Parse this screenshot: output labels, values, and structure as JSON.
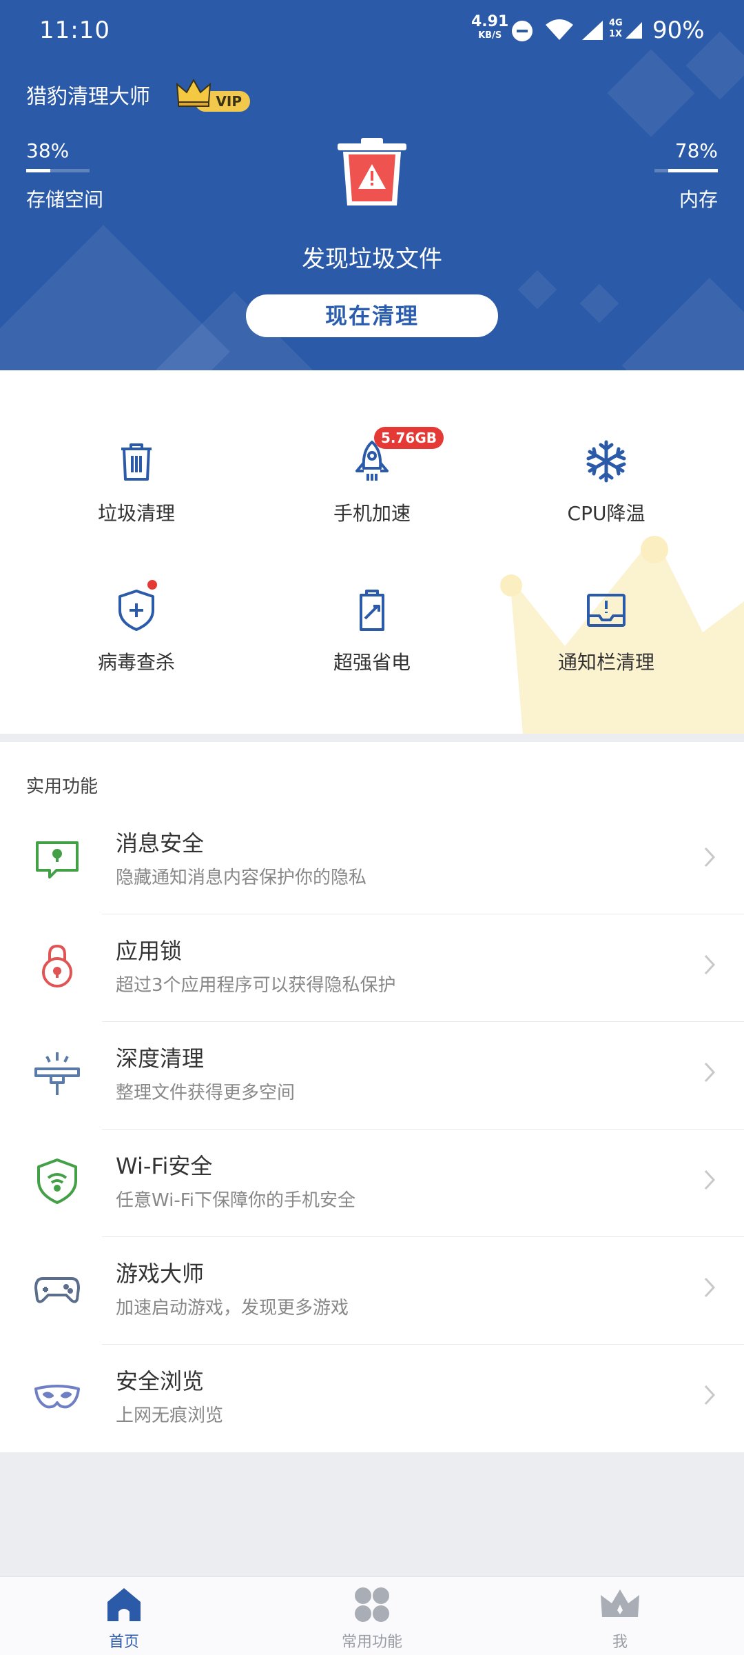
{
  "status_bar": {
    "time": "11:10",
    "net_speed": "4.91",
    "net_unit": "KB/S",
    "network_type_top": "4G",
    "network_type_bottom": "1X",
    "battery": "90%"
  },
  "header": {
    "app_title": "猎豹清理大师",
    "vip_label": "VIP",
    "storage": {
      "percent_text": "38%",
      "label": "存储空间",
      "fill_fraction": 0.38
    },
    "memory": {
      "percent_text": "78%",
      "label": "内存",
      "fill_fraction": 0.78
    },
    "found_text": "发现垃圾文件",
    "clean_button": "现在清理"
  },
  "tools": [
    {
      "label": "垃圾清理",
      "icon": "trash-icon"
    },
    {
      "label": "手机加速",
      "icon": "rocket-icon",
      "badge": "5.76GB"
    },
    {
      "label": "CPU降温",
      "icon": "snowflake-icon"
    },
    {
      "label": "病毒查杀",
      "icon": "shield-plus-icon"
    },
    {
      "label": "超强省电",
      "icon": "battery-icon"
    },
    {
      "label": "通知栏清理",
      "icon": "notification-tray-icon"
    }
  ],
  "utilities": {
    "section_title": "实用功能",
    "items": [
      {
        "title": "消息安全",
        "subtitle": "隐藏通知消息内容保护你的隐私",
        "icon": "message-lock-icon",
        "color": "#43a047"
      },
      {
        "title": "应用锁",
        "subtitle": "超过3个应用程序可以获得隐私保护",
        "icon": "padlock-icon",
        "color": "#e05454"
      },
      {
        "title": "深度清理",
        "subtitle": "整理文件获得更多空间",
        "icon": "deep-clean-icon",
        "color": "#5a7aa8"
      },
      {
        "title": "Wi-Fi安全",
        "subtitle": "任意Wi-Fi下保障你的手机安全",
        "icon": "wifi-shield-icon",
        "color": "#43a047"
      },
      {
        "title": "游戏大师",
        "subtitle": "加速启动游戏，发现更多游戏",
        "icon": "gamepad-icon",
        "color": "#5a6e8c"
      },
      {
        "title": "安全浏览",
        "subtitle": "上网无痕浏览",
        "icon": "mask-icon",
        "color": "#6f7fc4"
      }
    ]
  },
  "bottom_nav": [
    {
      "label": "首页",
      "icon": "home-icon",
      "active": true
    },
    {
      "label": "常用功能",
      "icon": "grid-icon",
      "active": false
    },
    {
      "label": "我",
      "icon": "crown-icon",
      "active": false
    }
  ],
  "colors": {
    "primary": "#2b5aa8",
    "danger": "#e53935",
    "accent_yellow": "#f2c94c"
  }
}
